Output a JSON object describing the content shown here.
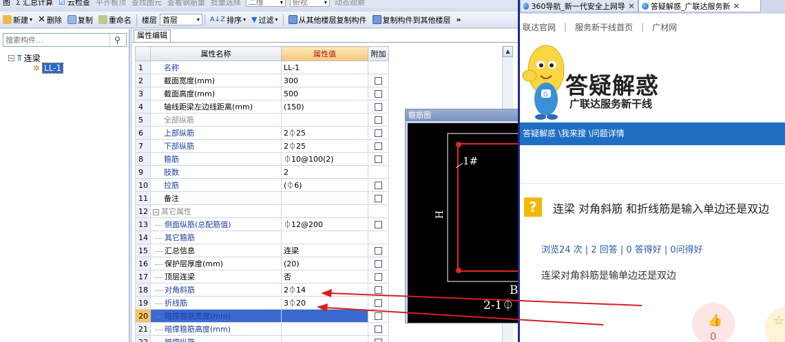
{
  "app": {
    "toolbar_top": [
      {
        "label": "图",
        "icon": "",
        "dim": false
      },
      {
        "label": "汇总计算",
        "icon": "sigma-icon",
        "dim": false
      },
      {
        "label": "云检查",
        "icon": "check-icon",
        "dim": false
      },
      {
        "label": "平齐板顶",
        "icon": "",
        "dim": true
      },
      {
        "label": "查找图元",
        "icon": "",
        "dim": true
      },
      {
        "label": "查看钢筋量",
        "icon": "",
        "dim": true
      },
      {
        "label": "批量选择",
        "icon": "",
        "dim": true
      }
    ],
    "toolbar_top_combos": [
      "二维",
      "俯视"
    ],
    "toolbar_top_dynamic": "动态观察",
    "toolbar": {
      "new": "新建",
      "delete": "删除",
      "copy": "复制",
      "rename": "重命名",
      "floor_label": "楼层",
      "floor_value": "首层",
      "sort": "排序",
      "filter": "过滤",
      "copy_from_other": "从其他楼层复制构件",
      "copy_to_other": "复制构件到其他楼层",
      "more": "»"
    },
    "search": {
      "placeholder": "搜索构件..."
    },
    "tree": {
      "root": "连梁",
      "child": "LL-1"
    },
    "prop_tab": "属性编辑",
    "grid_headers": {
      "name": "属性名称",
      "value": "属性值",
      "attach": "附加"
    },
    "rows": [
      {
        "n": "1",
        "name": "名称",
        "value": "LL-1",
        "style": "blue",
        "cb": false,
        "level": 0
      },
      {
        "n": "2",
        "name": "截面宽度(mm)",
        "value": "300",
        "style": "black",
        "cb": true,
        "level": 0
      },
      {
        "n": "3",
        "name": "截面高度(mm)",
        "value": "500",
        "style": "black",
        "cb": true,
        "level": 0
      },
      {
        "n": "4",
        "name": "轴线距梁左边线距离(mm)",
        "value": "(150)",
        "style": "black",
        "cb": true,
        "level": 0
      },
      {
        "n": "5",
        "name": "全部纵筋",
        "value": "",
        "style": "gray",
        "cb": true,
        "level": 0
      },
      {
        "n": "6",
        "name": "上部纵筋",
        "value": "2⏀25",
        "style": "blue",
        "cb": true,
        "level": 0
      },
      {
        "n": "7",
        "name": "下部纵筋",
        "value": "2⏀25",
        "style": "blue",
        "cb": true,
        "level": 0
      },
      {
        "n": "8",
        "name": "箍筋",
        "value": "⏀10@100(2)",
        "style": "blue",
        "cb": true,
        "level": 0
      },
      {
        "n": "9",
        "name": "肢数",
        "value": "2",
        "style": "blue",
        "cb": false,
        "level": 0
      },
      {
        "n": "10",
        "name": "拉筋",
        "value": "(⏀6)",
        "style": "blue",
        "cb": true,
        "level": 0
      },
      {
        "n": "11",
        "name": "备注",
        "value": "",
        "style": "black",
        "cb": true,
        "level": 0
      },
      {
        "n": "12",
        "name": "其它属性",
        "value": "",
        "style": "gray",
        "cb": false,
        "level": 0,
        "group": true
      },
      {
        "n": "13",
        "name": "侧面纵筋(总配筋值)",
        "value": "⏀12@200",
        "style": "blue",
        "cb": true,
        "level": 1
      },
      {
        "n": "14",
        "name": "其它箍筋",
        "value": "",
        "style": "blue",
        "cb": false,
        "level": 1
      },
      {
        "n": "15",
        "name": "汇总信息",
        "value": "连梁",
        "style": "black",
        "cb": true,
        "level": 1
      },
      {
        "n": "16",
        "name": "保护层厚度(mm)",
        "value": "(20)",
        "style": "black",
        "cb": true,
        "level": 1
      },
      {
        "n": "17",
        "name": "顶层连梁",
        "value": "否",
        "style": "black",
        "cb": true,
        "level": 1
      },
      {
        "n": "18",
        "name": "对角斜筋",
        "value": "2⏀14",
        "style": "blue",
        "cb": true,
        "level": 1
      },
      {
        "n": "19",
        "name": "折线筋",
        "value": "3⏀20",
        "style": "blue",
        "cb": true,
        "level": 1
      },
      {
        "n": "20",
        "name": "暗撑箍筋宽度(mm)",
        "value": "",
        "style": "blue",
        "cb": true,
        "level": 1,
        "selected": true
      },
      {
        "n": "21",
        "name": "暗撑箍筋高度(mm)",
        "value": "",
        "style": "blue",
        "cb": true,
        "level": 1
      },
      {
        "n": "22",
        "name": "暗撑纵筋",
        "value": "",
        "style": "blue",
        "cb": true,
        "level": 1
      }
    ],
    "stirrup": {
      "title": "箍筋图",
      "label_1": "1#",
      "label_h": "H",
      "label_b": "B",
      "label_bottom": "2-1⏀"
    }
  },
  "browser": {
    "tabs": [
      {
        "label": "360导航_新一代安全上网导",
        "active": false
      },
      {
        "label": "答疑解惑_广联达服务新",
        "active": true
      }
    ],
    "links": [
      "联达官网",
      "服务新干线首页",
      "广材网"
    ],
    "brand_title": "答疑解惑",
    "brand_sub": "广联达服务新干线",
    "breadcrumb": "答疑解惑 \\我来搜 \\问题详情",
    "question_title": "连梁 对角斜筋 和折线筋是输入单边还是双边",
    "question_stats": "浏览24 次 | 2 回答 | 0 答得好 | 0问得好",
    "question_body": "连梁对角斜筋是输单边还是双边",
    "like_count": "0",
    "colors": {
      "accent_blue": "#1f6ec2",
      "question_icon": "#f5b800",
      "arrow_red": "#d81e1e"
    }
  }
}
